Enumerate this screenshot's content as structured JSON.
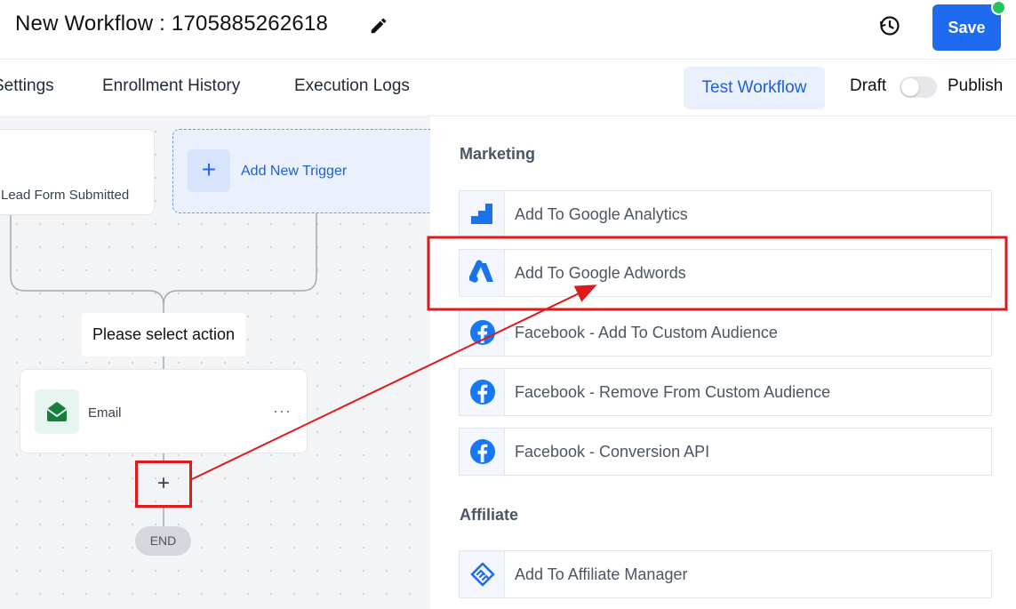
{
  "header": {
    "title": "New Workflow : 1705885262618",
    "save_label": "Save",
    "icons": {
      "edit": "pencil-icon",
      "history": "history-icon"
    }
  },
  "tabs": {
    "items": [
      "Settings",
      "Enrollment History",
      "Execution Logs"
    ],
    "test_label": "Test Workflow",
    "draft_label": "Draft",
    "publish_label": "Publish",
    "publish_enabled": false
  },
  "canvas": {
    "trigger_label": "Lead Form Submitted",
    "add_trigger_label": "Add New Trigger",
    "select_action_label": "Please select action",
    "email_label": "Email",
    "more_label": "···",
    "add_label": "+",
    "end_label": "END"
  },
  "panel": {
    "sections": [
      {
        "title": "Marketing",
        "items": [
          {
            "label": "Add To Google Analytics",
            "icon": "google-analytics-icon"
          },
          {
            "label": "Add To Google Adwords",
            "icon": "google-adwords-icon"
          },
          {
            "label": "Facebook - Add To Custom Audience",
            "icon": "facebook-icon"
          },
          {
            "label": "Facebook - Remove From Custom Audience",
            "icon": "facebook-icon"
          },
          {
            "label": "Facebook - Conversion API",
            "icon": "facebook-icon"
          }
        ]
      },
      {
        "title": "Affiliate",
        "items": [
          {
            "label": "Add To Affiliate Manager",
            "icon": "handshake-icon"
          }
        ]
      }
    ]
  },
  "colors": {
    "primary": "#1f6bf0",
    "highlight": "#e0191b",
    "status_dot": "#22c55e",
    "email_green": "#15803d",
    "facebook_blue": "#1877f2"
  }
}
